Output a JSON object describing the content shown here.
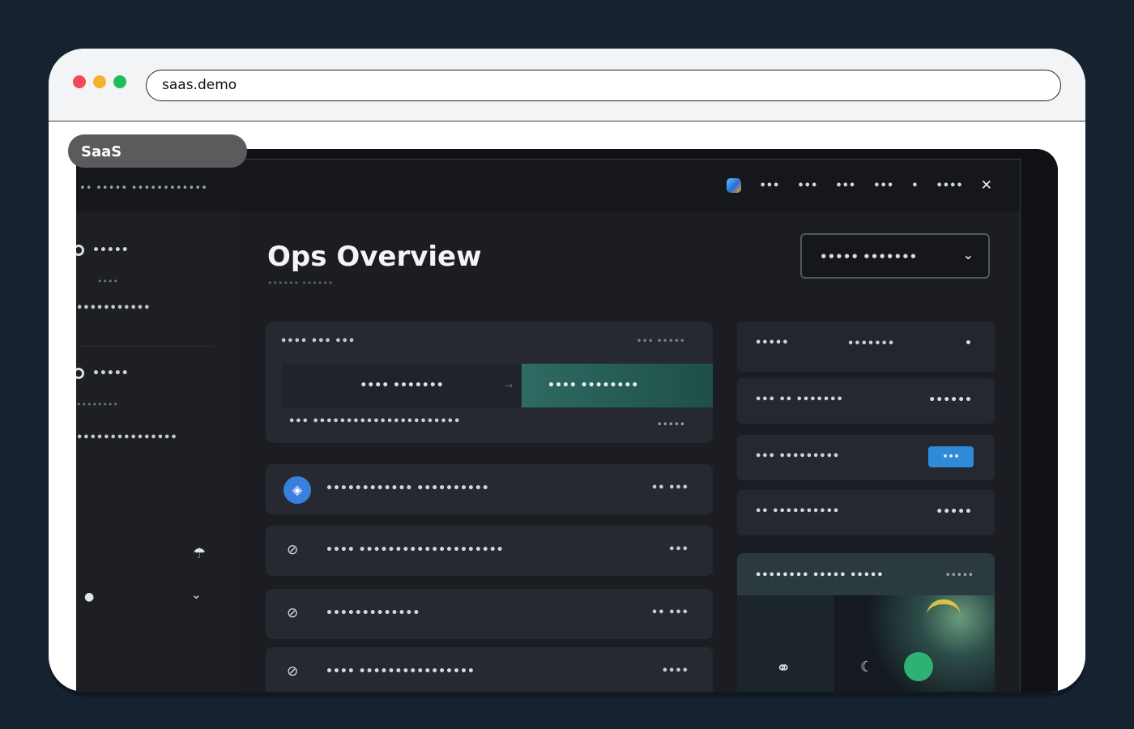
{
  "browser": {
    "url": "saas.demo"
  },
  "badge": "SaaS",
  "app": {
    "brand": "•• ••••• ••••••••••••",
    "topnav": [
      "•••",
      "•••",
      "•••",
      "•••",
      "•",
      "••••"
    ],
    "sidebar": {
      "items": [
        {
          "label": "•••••",
          "sub": "••••"
        },
        {
          "label": "•••••••••••"
        },
        {
          "label": "•••••",
          "sub": "••••••••"
        },
        {
          "label": "•••••••••••••••"
        }
      ]
    },
    "title": "Ops Overview",
    "subtitle": "•••••• ••••••",
    "select": {
      "value": "••••• •••••••"
    },
    "summary_card": {
      "head": "•••• ••• •••",
      "head_right": "••• •••••",
      "segment_left": "•••• •••••••",
      "segment_right": "•••• ••••••••",
      "foot": "••• ••••••••••••••••••••••",
      "foot_right": "•••••"
    },
    "rows": [
      {
        "label": "•••••••••••• ••••••••••",
        "value": "•• •••"
      },
      {
        "label": "•••• ••••••••••••••••••••",
        "value": "•••"
      },
      {
        "label": "•••••••••••••",
        "value": "•• •••"
      },
      {
        "label": "•••• ••••••••••••••••",
        "value": "••••"
      }
    ],
    "right_panel": {
      "head": {
        "label": "•••••",
        "mid": "•••••••",
        "val": "•"
      },
      "items": [
        {
          "label": "••• •• •••••••",
          "value": "••••••"
        },
        {
          "label": "••• •••••••••",
          "value": "•••"
        },
        {
          "label": "•• ••••••••••",
          "value": "•••••"
        }
      ]
    },
    "preview_card": {
      "label": "•••••••• ••••• •••••",
      "value": "•••••"
    }
  },
  "colors": {
    "page_bg": "#172231",
    "app_bg": "#1b1d22",
    "accent_teal": "#2e6b62",
    "accent_blue": "#2f8bd8"
  }
}
